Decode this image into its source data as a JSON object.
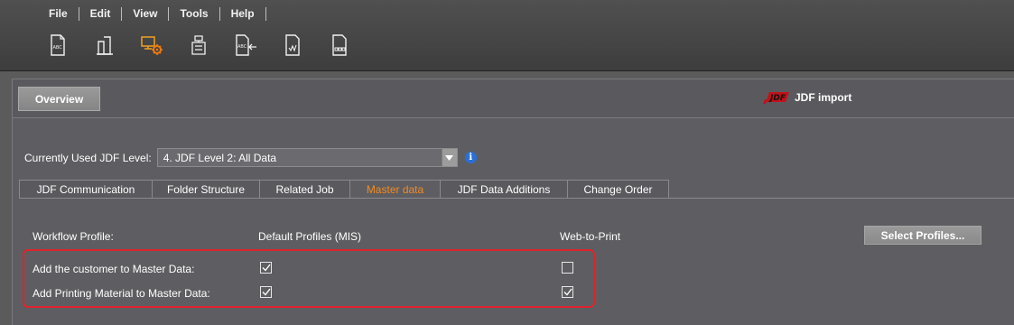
{
  "menu": {
    "items": [
      "File",
      "Edit",
      "View",
      "Tools",
      "Help"
    ]
  },
  "toolbar": {
    "icons": [
      "abc-document-icon",
      "book-icon",
      "settings-computer-icon",
      "job-ticket-icon",
      "abc-import-icon",
      "signature-document-icon",
      "sequence-document-icon"
    ]
  },
  "header": {
    "overview_label": "Overview",
    "title": "JDF import",
    "logo_text": "JDF"
  },
  "level": {
    "label": "Currently Used JDF Level:",
    "value": "4. JDF Level 2: All Data",
    "info_glyph": "i"
  },
  "tabs": [
    {
      "label": "JDF Communication",
      "active": false
    },
    {
      "label": "Folder Structure",
      "active": false
    },
    {
      "label": "Related Job",
      "active": false
    },
    {
      "label": "Master data",
      "active": true
    },
    {
      "label": "JDF Data Additions",
      "active": false
    },
    {
      "label": "Change Order",
      "active": false
    }
  ],
  "master": {
    "col_workflow": "Workflow Profile:",
    "col_default": "Default Profiles (MIS)",
    "col_web": "Web-to-Print",
    "select_profiles_label": "Select Profiles...",
    "rows": [
      {
        "label": "Add the customer to Master Data:",
        "default_checked": true,
        "web_checked": false
      },
      {
        "label": "Add Printing Material to Master Data:",
        "default_checked": true,
        "web_checked": true
      }
    ]
  },
  "colors": {
    "accent_active_tab": "#f08a24",
    "highlight": "#e0232c",
    "info": "#2a6fd6"
  }
}
